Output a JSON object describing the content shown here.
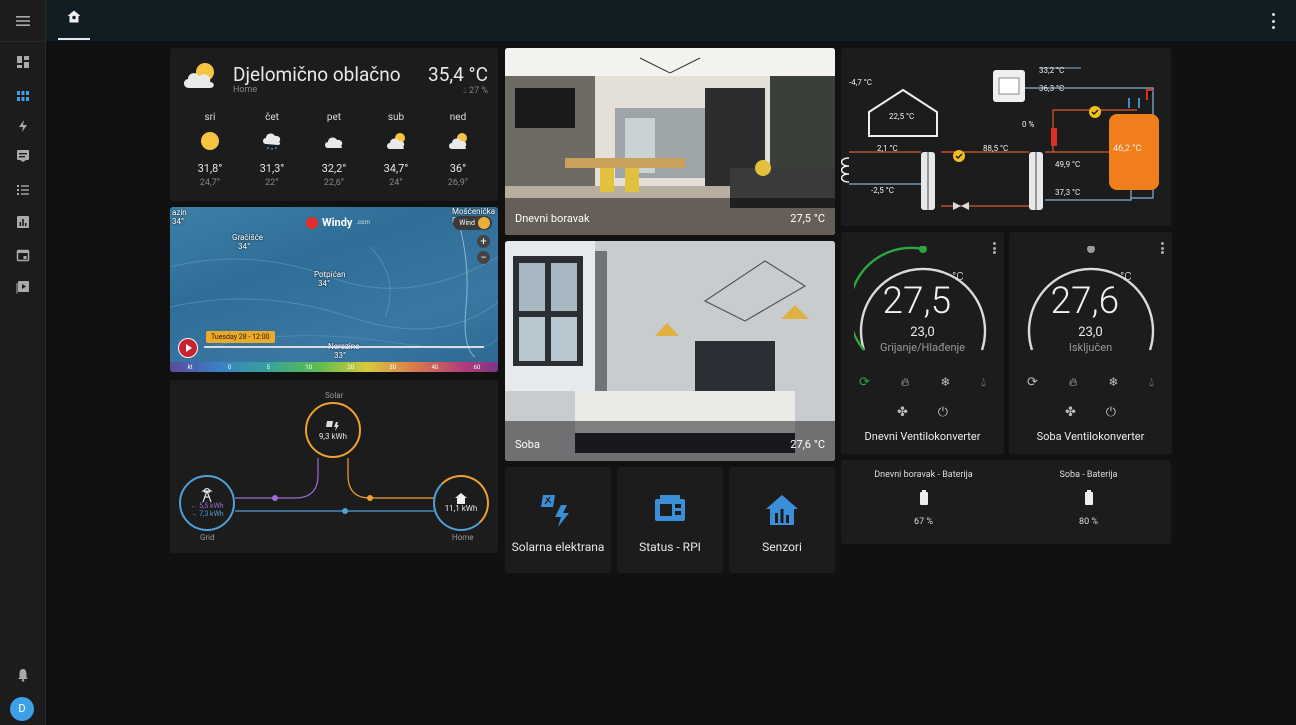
{
  "sidebar": {
    "items": [
      {
        "icon": "menu-icon"
      },
      {
        "icon": "dashboard-icon"
      },
      {
        "icon": "grid-dashboard-icon"
      },
      {
        "icon": "energy-icon"
      },
      {
        "icon": "logbook-icon"
      },
      {
        "icon": "todo-list-icon"
      },
      {
        "icon": "history-icon"
      },
      {
        "icon": "calendar-icon"
      },
      {
        "icon": "media-icon"
      },
      {
        "icon": "notifications-icon"
      }
    ],
    "avatar": "D"
  },
  "header": {
    "active_tab_icon": "home-icon"
  },
  "weather": {
    "condition": "Djelomično oblačno",
    "location": "Home",
    "temperature": "35,4 °C",
    "humidity": "27 %",
    "forecast": [
      {
        "day": "sri",
        "icon": "sunny-icon",
        "high": "31,8°",
        "low": "24,7°"
      },
      {
        "day": "čet",
        "icon": "rainy-icon",
        "high": "31,3°",
        "low": "22°"
      },
      {
        "day": "pet",
        "icon": "cloudy-icon",
        "high": "32,2°",
        "low": "22,6°"
      },
      {
        "day": "sub",
        "icon": "partly-cloudy-icon",
        "high": "34,7°",
        "low": "24°"
      },
      {
        "day": "ned",
        "icon": "partly-cloudy-icon",
        "high": "36°",
        "low": "26,9°"
      }
    ]
  },
  "map": {
    "logo": "Windy",
    "logo_suffix": ".com",
    "wind_label": "Wind",
    "places": [
      {
        "name": "Gračišće",
        "value": "34°"
      },
      {
        "name": "Potpićan",
        "value": "34°"
      },
      {
        "name": "azin",
        "value": "34°"
      },
      {
        "name": "Mošćenička D",
        "value": ""
      },
      {
        "name": "Nerezine",
        "value": "33°"
      }
    ],
    "timestamp": "Tuesday 28 - 12:00",
    "scale_unit": "kt",
    "scale": [
      "0",
      "5",
      "10",
      "20",
      "30",
      "40",
      "60"
    ]
  },
  "energy": {
    "solar_label": "Solar",
    "solar_value": "9,3 kWh",
    "grid_label": "Grid",
    "grid_in": "← 5,5 kWh",
    "grid_out": "→ 7,3 kWh",
    "home_label": "Home",
    "home_value": "11,1 kWh"
  },
  "pictures": {
    "living": {
      "title": "Dnevni boravak",
      "value": "27,5 °C"
    },
    "bedroom": {
      "title": "Soba",
      "value": "27,6 °C"
    }
  },
  "buttons": [
    {
      "label": "Solarna elektrana",
      "icon": "solar-power-icon"
    },
    {
      "label": "Status - RPI",
      "icon": "raspberry-pi-icon"
    },
    {
      "label": "Senzori",
      "icon": "home-sensors-icon"
    }
  ],
  "heatpump": {
    "outdoor": "-4,7 °C",
    "indoor": "22,5 °C",
    "t_2_1": "2,1 °C",
    "t_m2_5": "-2,5 °C",
    "t_88_5": "88,5 °C",
    "percent": "0 %",
    "t_33_2": "33,2 °C",
    "t_36_3": "36,3 °C",
    "t_49_9": "49,9 °C",
    "t_37_3": "37,3 °C",
    "tank": "46,2 °C"
  },
  "thermostats": [
    {
      "name": "Dnevni Ventilokonverter",
      "current": "27,5",
      "unit": "°C",
      "target": "23,0",
      "mode": "Grijanje/Hlađenje",
      "arc_color": "#2ba840"
    },
    {
      "name": "Soba Ventilokonverter",
      "current": "27,6",
      "unit": "°C",
      "target": "23,0",
      "mode": "Isključen",
      "arc_color": "#cfcfcf"
    }
  ],
  "battery": [
    {
      "name": "Dnevni boravak - Baterija",
      "value": "67 %"
    },
    {
      "name": "Soba - Baterija",
      "value": "80 %"
    }
  ]
}
